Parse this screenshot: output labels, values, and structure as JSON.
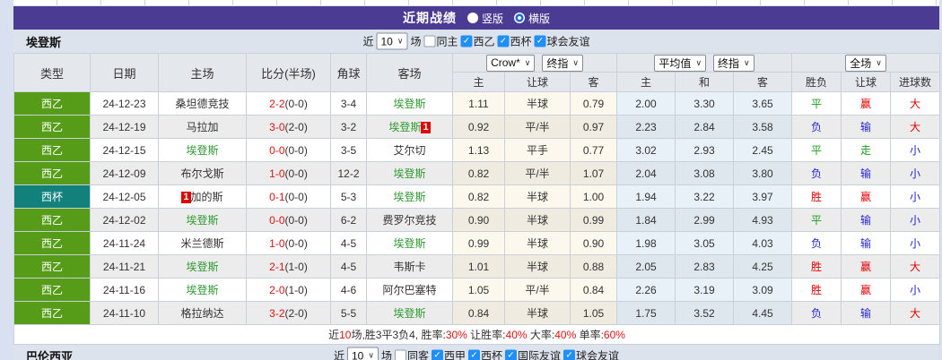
{
  "titlebar": {
    "title": "近期战绩",
    "radio_vertical": "竖版",
    "radio_horizontal": "横版"
  },
  "filter_top": {
    "team": "埃登斯",
    "recent_label": "近",
    "count_value": "10",
    "matches_label": "场",
    "same_venue_label": "同主",
    "leagues": [
      "西乙",
      "西杯",
      "球会友谊"
    ]
  },
  "filter_bottom": {
    "team": "巴伦西亚",
    "recent_label": "近",
    "count_value": "10",
    "matches_label": "场",
    "same_venue_label": "同客",
    "leagues": [
      "西甲",
      "西杯",
      "国际友谊",
      "球会友谊"
    ]
  },
  "table": {
    "dropdowns": {
      "odds_source": "Crow*",
      "odds_time": "终指",
      "europe_source": "平均值",
      "europe_time": "终指",
      "result_scope": "全场"
    },
    "columns": {
      "type": "类型",
      "date": "日期",
      "home": "主场",
      "score": "比分(半场)",
      "corner": "角球",
      "away": "客场",
      "odds_home": "主",
      "odds_handicap": "让球",
      "odds_away": "客",
      "euro_home": "主",
      "euro_draw": "和",
      "euro_away": "客",
      "res_wdl": "胜负",
      "res_handicap": "让球",
      "res_goals": "进球数"
    },
    "rows": [
      {
        "league": "西乙",
        "league_color": "green",
        "date": "24-12-23",
        "home": "桑坦德竞技",
        "home_badge": "",
        "score": "2-2",
        "half": "(0-0)",
        "corner": "3-4",
        "away": "埃登斯",
        "away_badge": "",
        "odds": [
          "1.11",
          "半球",
          "0.79"
        ],
        "avg": [
          "2.00",
          "3.30",
          "3.65"
        ],
        "results": [
          {
            "t": "平",
            "c": "green"
          },
          {
            "t": "赢",
            "c": "red"
          },
          {
            "t": "大",
            "c": "red"
          }
        ]
      },
      {
        "league": "西乙",
        "league_color": "green",
        "date": "24-12-19",
        "home": "马拉加",
        "home_badge": "",
        "score": "3-0",
        "half": "(2-0)",
        "corner": "3-2",
        "away": "埃登斯",
        "away_badge": "1",
        "odds": [
          "0.92",
          "平/半",
          "0.97"
        ],
        "avg": [
          "2.23",
          "2.84",
          "3.58"
        ],
        "results": [
          {
            "t": "负",
            "c": "blue"
          },
          {
            "t": "输",
            "c": "blue"
          },
          {
            "t": "大",
            "c": "red"
          }
        ]
      },
      {
        "league": "西乙",
        "league_color": "green",
        "date": "24-12-15",
        "home": "埃登斯",
        "home_badge": "",
        "score": "0-0",
        "half": "(0-0)",
        "corner": "3-5",
        "away": "艾尔切",
        "away_badge": "",
        "odds": [
          "1.13",
          "平手",
          "0.77"
        ],
        "avg": [
          "3.02",
          "2.93",
          "2.45"
        ],
        "results": [
          {
            "t": "平",
            "c": "green"
          },
          {
            "t": "走",
            "c": "green"
          },
          {
            "t": "小",
            "c": "blue"
          }
        ]
      },
      {
        "league": "西乙",
        "league_color": "green",
        "date": "24-12-09",
        "home": "布尔戈斯",
        "home_badge": "",
        "score": "1-0",
        "half": "(0-0)",
        "corner": "12-2",
        "away": "埃登斯",
        "away_badge": "",
        "odds": [
          "0.82",
          "平/半",
          "1.07"
        ],
        "avg": [
          "2.04",
          "3.08",
          "3.80"
        ],
        "results": [
          {
            "t": "负",
            "c": "blue"
          },
          {
            "t": "输",
            "c": "blue"
          },
          {
            "t": "小",
            "c": "blue"
          }
        ]
      },
      {
        "league": "西杯",
        "league_color": "teal",
        "date": "24-12-05",
        "home": "加的斯",
        "home_badge": "1",
        "score": "0-1",
        "half": "(0-0)",
        "corner": "5-3",
        "away": "埃登斯",
        "away_badge": "",
        "odds": [
          "0.82",
          "半球",
          "1.00"
        ],
        "avg": [
          "1.94",
          "3.22",
          "3.97"
        ],
        "results": [
          {
            "t": "胜",
            "c": "red"
          },
          {
            "t": "赢",
            "c": "red"
          },
          {
            "t": "小",
            "c": "blue"
          }
        ]
      },
      {
        "league": "西乙",
        "league_color": "green",
        "date": "24-12-02",
        "home": "埃登斯",
        "home_badge": "",
        "score": "0-0",
        "half": "(0-0)",
        "corner": "6-2",
        "away": "费罗尔竞技",
        "away_badge": "",
        "odds": [
          "0.90",
          "半球",
          "0.99"
        ],
        "avg": [
          "1.84",
          "2.99",
          "4.93"
        ],
        "results": [
          {
            "t": "平",
            "c": "green"
          },
          {
            "t": "输",
            "c": "blue"
          },
          {
            "t": "小",
            "c": "blue"
          }
        ]
      },
      {
        "league": "西乙",
        "league_color": "green",
        "date": "24-11-24",
        "home": "米兰德斯",
        "home_badge": "",
        "score": "1-0",
        "half": "(0-0)",
        "corner": "4-5",
        "away": "埃登斯",
        "away_badge": "",
        "odds": [
          "0.99",
          "半球",
          "0.90"
        ],
        "avg": [
          "1.98",
          "3.05",
          "4.03"
        ],
        "results": [
          {
            "t": "负",
            "c": "blue"
          },
          {
            "t": "输",
            "c": "blue"
          },
          {
            "t": "小",
            "c": "blue"
          }
        ]
      },
      {
        "league": "西乙",
        "league_color": "green",
        "date": "24-11-21",
        "home": "埃登斯",
        "home_badge": "",
        "score": "2-1",
        "half": "(1-0)",
        "corner": "4-5",
        "away": "韦斯卡",
        "away_badge": "",
        "odds": [
          "1.01",
          "半球",
          "0.88"
        ],
        "avg": [
          "2.05",
          "2.83",
          "4.25"
        ],
        "results": [
          {
            "t": "胜",
            "c": "red"
          },
          {
            "t": "赢",
            "c": "red"
          },
          {
            "t": "大",
            "c": "red"
          }
        ]
      },
      {
        "league": "西乙",
        "league_color": "green",
        "date": "24-11-16",
        "home": "埃登斯",
        "home_badge": "",
        "score": "2-0",
        "half": "(1-0)",
        "corner": "4-6",
        "away": "阿尔巴塞特",
        "away_badge": "",
        "odds": [
          "1.05",
          "平/半",
          "0.84"
        ],
        "avg": [
          "2.26",
          "3.19",
          "3.09"
        ],
        "results": [
          {
            "t": "胜",
            "c": "red"
          },
          {
            "t": "赢",
            "c": "red"
          },
          {
            "t": "小",
            "c": "blue"
          }
        ]
      },
      {
        "league": "西乙",
        "league_color": "green",
        "date": "24-11-10",
        "home": "格拉纳达",
        "home_badge": "",
        "score": "3-2",
        "half": "(2-0)",
        "corner": "5-5",
        "away": "埃登斯",
        "away_badge": "",
        "odds": [
          "0.84",
          "半球",
          "1.05"
        ],
        "avg": [
          "1.75",
          "3.52",
          "4.45"
        ],
        "results": [
          {
            "t": "负",
            "c": "blue"
          },
          {
            "t": "输",
            "c": "blue"
          },
          {
            "t": "大",
            "c": "red"
          }
        ]
      }
    ],
    "summary": {
      "segments": [
        {
          "text": "近",
          "red": false
        },
        {
          "text": "10",
          "red": true
        },
        {
          "text": "场,胜3平3负4, 胜率:",
          "red": false
        },
        {
          "text": "30%",
          "red": true
        },
        {
          "text": " 让胜率:",
          "red": false
        },
        {
          "text": "40%",
          "red": true
        },
        {
          "text": " 大率:",
          "red": false
        },
        {
          "text": "40%",
          "red": true
        },
        {
          "text": " 单率:",
          "red": false
        },
        {
          "text": "60%",
          "red": true
        }
      ]
    }
  },
  "colors": {
    "header_purple": "#4b3b92",
    "league_green": "#579c19",
    "cup_teal": "#12807b",
    "focus_team_green": "#2f9a31",
    "score_red": "#e11212",
    "win_red": "#e00000",
    "lose_blue": "#2424d4",
    "draw_green": "#1e9a1e",
    "checkbox_blue": "#1f8fff"
  },
  "icons": {
    "checkbox_tick": "✓",
    "select_chevron": "∨"
  }
}
